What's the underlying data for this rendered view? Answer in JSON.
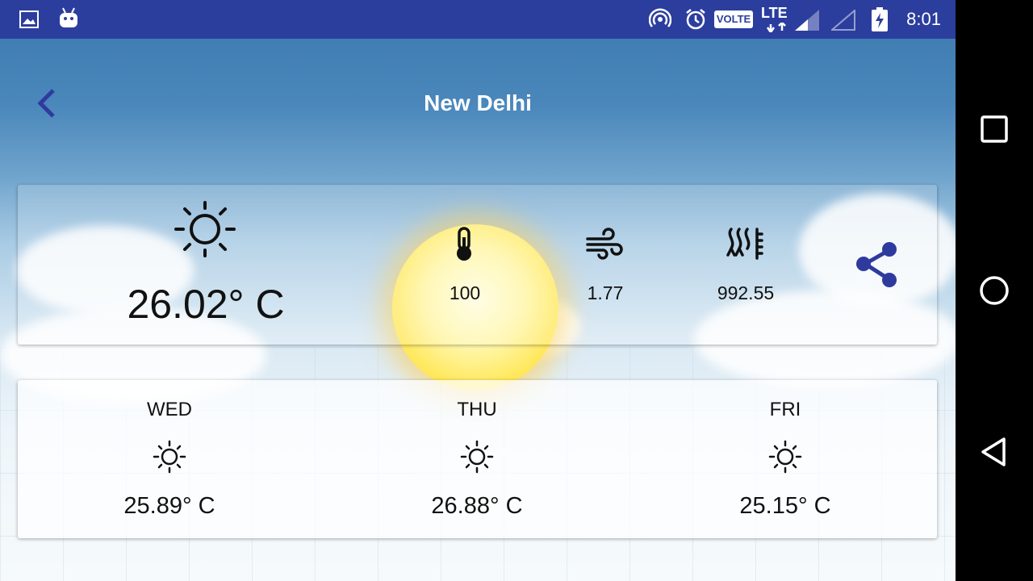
{
  "status_bar": {
    "time": "8:01",
    "network": "LTE",
    "volte": "VOLTE"
  },
  "header": {
    "city": "New Delhi"
  },
  "current": {
    "temperature": "26.02° C",
    "condition_icon": "sun-icon",
    "humidity": "100",
    "wind": "1.77",
    "pressure": "992.55"
  },
  "forecast": [
    {
      "day": "WED",
      "temp": "25.89° C",
      "icon": "sun-icon"
    },
    {
      "day": "THU",
      "temp": "26.88° C",
      "icon": "sun-icon"
    },
    {
      "day": "FRI",
      "temp": "25.15° C",
      "icon": "sun-icon"
    }
  ],
  "colors": {
    "status_bar": "#2b3e9e",
    "accent": "#2f3a9e",
    "sun": "#ffd12e"
  }
}
